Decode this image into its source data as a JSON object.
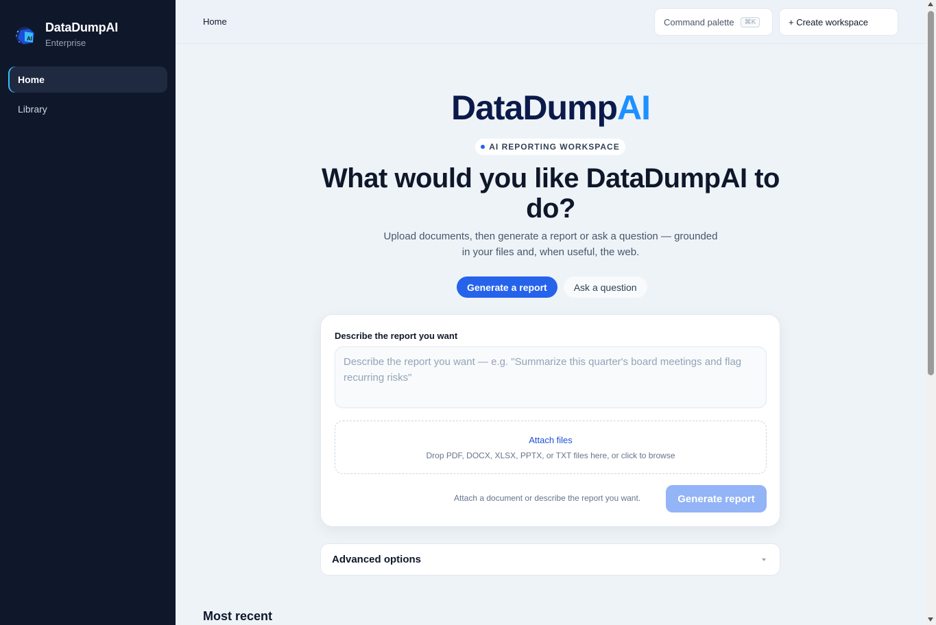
{
  "app": {
    "brand_name": "DataDumpAI",
    "brand_sub": "Enterprise",
    "logo_icon": "ai-cube-logo-icon"
  },
  "sidebar": {
    "items": [
      {
        "label": "Home",
        "active": true
      },
      {
        "label": "Library",
        "active": false
      }
    ]
  },
  "header": {
    "breadcrumb": "Home",
    "command_palette": "Command palette",
    "shortcut": "⌘K",
    "create_workspace": "+ Create workspace"
  },
  "hero": {
    "logo_main": "DataDump",
    "logo_accent": "AI",
    "badge": "AI REPORTING WORKSPACE",
    "headline": "What would you like DataDumpAI to do?",
    "subline": "Upload documents, then generate a report or ask a question — grounded in your files and, when useful, the web."
  },
  "modes": {
    "generate": "Generate a report",
    "ask": "Ask a question"
  },
  "form": {
    "label": "Describe the report you want",
    "placeholder": "Describe the report you want — e.g. \"Summarize this quarter's board meetings and flag recurring risks\"",
    "attach_title": "Attach files",
    "attach_hint": "Drop PDF, DOCX, XLSX, PPTX, or TXT files here, or click to browse",
    "hint": "Attach a document or describe the report you want.",
    "submit": "Generate report"
  },
  "advanced": {
    "label": "Advanced options"
  },
  "recent": {
    "title": "Most recent"
  },
  "colors": {
    "sidebar_bg": "#0f172a",
    "accent": "#2563eb",
    "accent_disabled": "#93b4f6",
    "logo_ai": "#1e90ff"
  }
}
